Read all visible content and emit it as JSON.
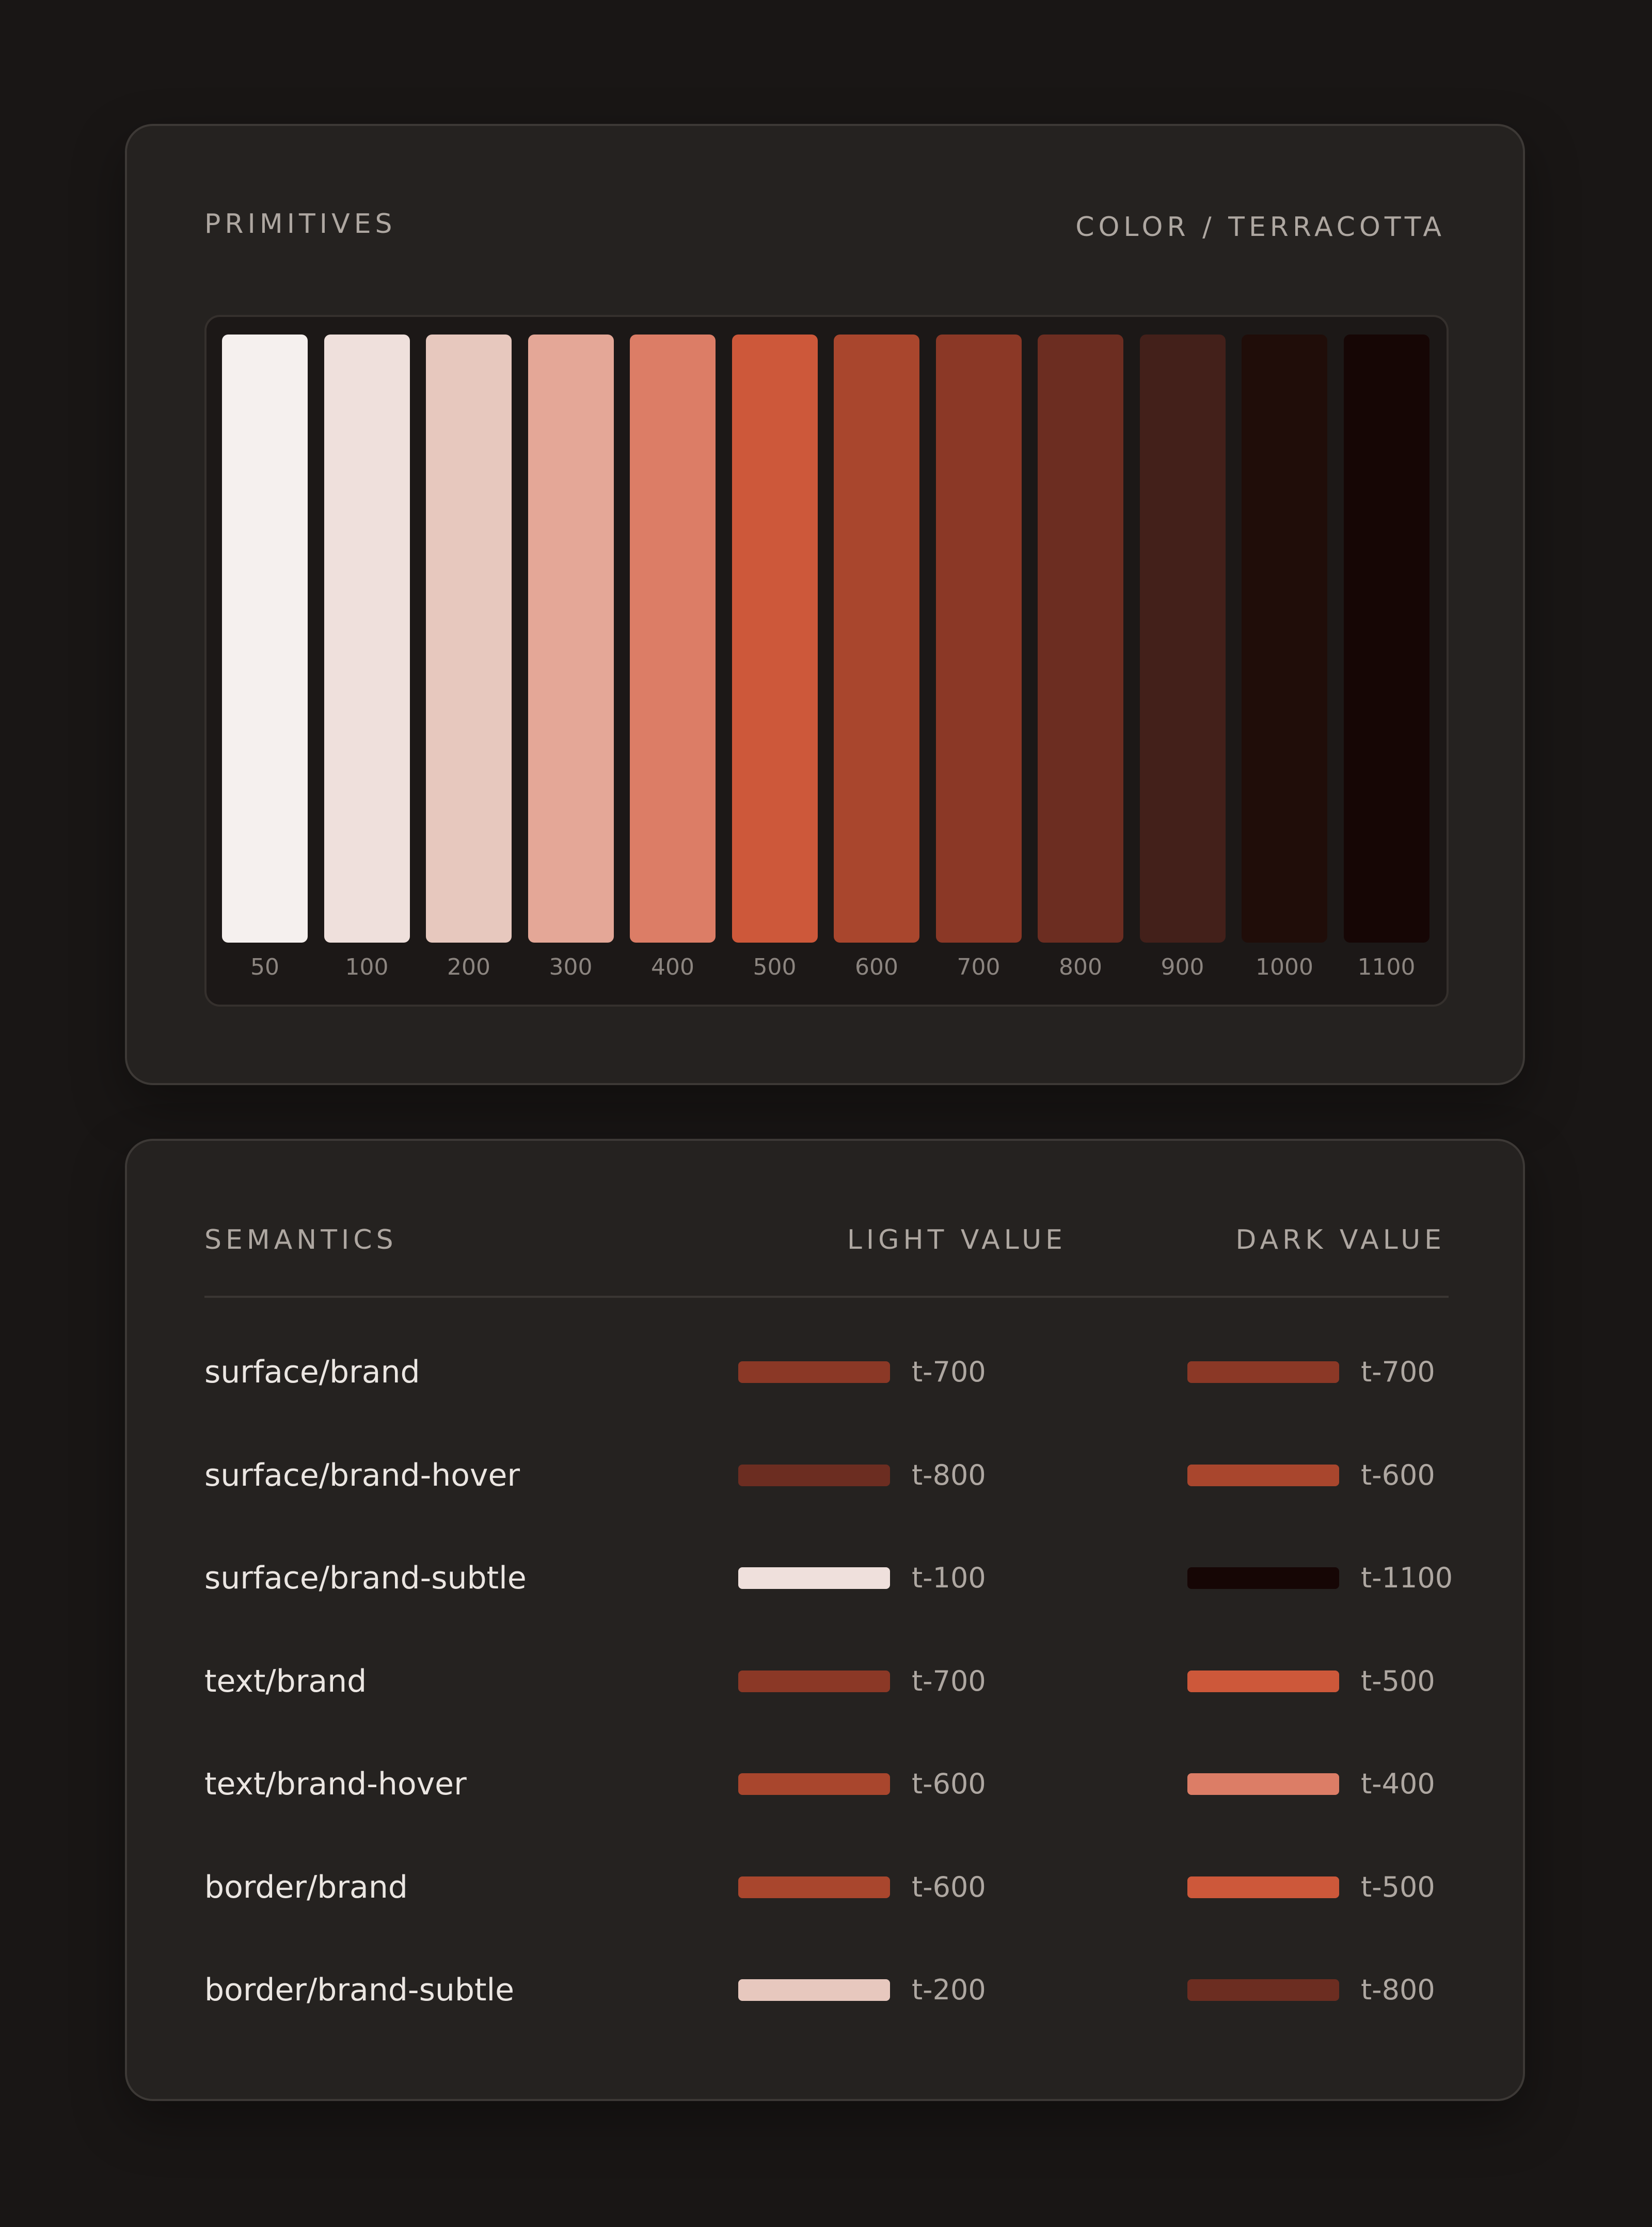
{
  "primitives": {
    "heading": "PRIMITIVES",
    "subtitle": "COLOR / TERRACOTTA",
    "swatches": [
      {
        "label": "50",
        "color": "#f5f0ee"
      },
      {
        "label": "100",
        "color": "#efe0dc"
      },
      {
        "label": "200",
        "color": "#e7c8be"
      },
      {
        "label": "300",
        "color": "#e4a797"
      },
      {
        "label": "400",
        "color": "#dc7d66"
      },
      {
        "label": "500",
        "color": "#cd583a"
      },
      {
        "label": "600",
        "color": "#a9462d"
      },
      {
        "label": "700",
        "color": "#8b3826"
      },
      {
        "label": "800",
        "color": "#6c2d21"
      },
      {
        "label": "900",
        "color": "#43201a"
      },
      {
        "label": "1000",
        "color": "#200d09"
      },
      {
        "label": "1100",
        "color": "#160605"
      }
    ]
  },
  "semantics": {
    "heading": "SEMANTICS",
    "light_heading": "LIGHT VALUE",
    "dark_heading": "DARK VALUE",
    "rows": [
      {
        "name": "surface/brand",
        "light": {
          "label": "t-700",
          "color": "#8b3826"
        },
        "dark": {
          "label": "t-700",
          "color": "#8b3826"
        }
      },
      {
        "name": "surface/brand-hover",
        "light": {
          "label": "t-800",
          "color": "#6c2d21"
        },
        "dark": {
          "label": "t-600",
          "color": "#a9462d"
        }
      },
      {
        "name": "surface/brand-subtle",
        "light": {
          "label": "t-100",
          "color": "#efe0dc"
        },
        "dark": {
          "label": "t-1100",
          "color": "#160605"
        }
      },
      {
        "name": "text/brand",
        "light": {
          "label": "t-700",
          "color": "#8b3826"
        },
        "dark": {
          "label": "t-500",
          "color": "#cd583a"
        }
      },
      {
        "name": "text/brand-hover",
        "light": {
          "label": "t-600",
          "color": "#a9462d"
        },
        "dark": {
          "label": "t-400",
          "color": "#dc7d66"
        }
      },
      {
        "name": "border/brand",
        "light": {
          "label": "t-600",
          "color": "#a9462d"
        },
        "dark": {
          "label": "t-500",
          "color": "#cd583a"
        }
      },
      {
        "name": "border/brand-subtle",
        "light": {
          "label": "t-200",
          "color": "#e7c8be"
        },
        "dark": {
          "label": "t-800",
          "color": "#6c2d21"
        }
      }
    ]
  }
}
